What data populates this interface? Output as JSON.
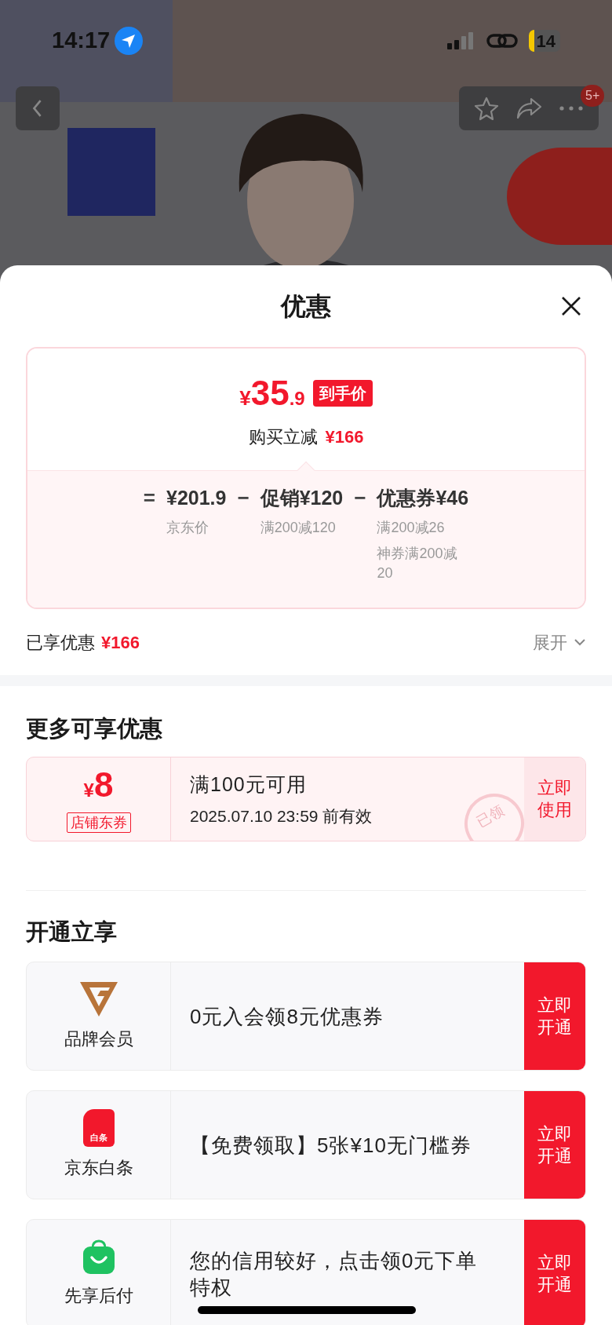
{
  "status_bar": {
    "time": "14:17",
    "battery": "14"
  },
  "top_bar": {
    "badge": "5+"
  },
  "sheet": {
    "title": "优惠"
  },
  "price_card": {
    "currency": "¥",
    "price_integer": "35",
    "price_decimal": ".9",
    "price_tag": "到手价",
    "saving_label": "购买立减",
    "saving_value": "¥166",
    "breakdown": [
      {
        "kind": "operator",
        "text": "="
      },
      {
        "kind": "term",
        "text": "¥201.9",
        "notes": [
          "京东价"
        ]
      },
      {
        "kind": "operator",
        "text": "−"
      },
      {
        "kind": "term",
        "text": "促销¥120",
        "notes": [
          "满200减120"
        ]
      },
      {
        "kind": "operator",
        "text": "−"
      },
      {
        "kind": "term",
        "text": "优惠券¥46",
        "notes": [
          "满200减26",
          "神券满200减20"
        ]
      }
    ]
  },
  "summary": {
    "label": "已享优惠",
    "value": "¥166",
    "expand": "展开"
  },
  "more_offers": {
    "title": "更多可享优惠",
    "coupon": {
      "currency": "¥",
      "amount": "8",
      "tag": "店铺东券",
      "condition": "满100元可用",
      "validity": "2025.07.10 23:59 前有效",
      "action": "立即使用",
      "stamp": "已领"
    }
  },
  "join_offers": {
    "title": "开通立享",
    "items": [
      {
        "kind": "brand",
        "name": "品牌会员",
        "text": "0元入会领8元优惠券",
        "action": "立即开通"
      },
      {
        "kind": "credit",
        "icon_text": "白条",
        "name": "京东白条",
        "text": "【免费领取】5张¥10无门槛券",
        "action": "立即开通"
      },
      {
        "kind": "paylater",
        "name": "先享后付",
        "text": "您的信用较好，点击领0元下单特权",
        "action": "立即开通"
      }
    ]
  }
}
